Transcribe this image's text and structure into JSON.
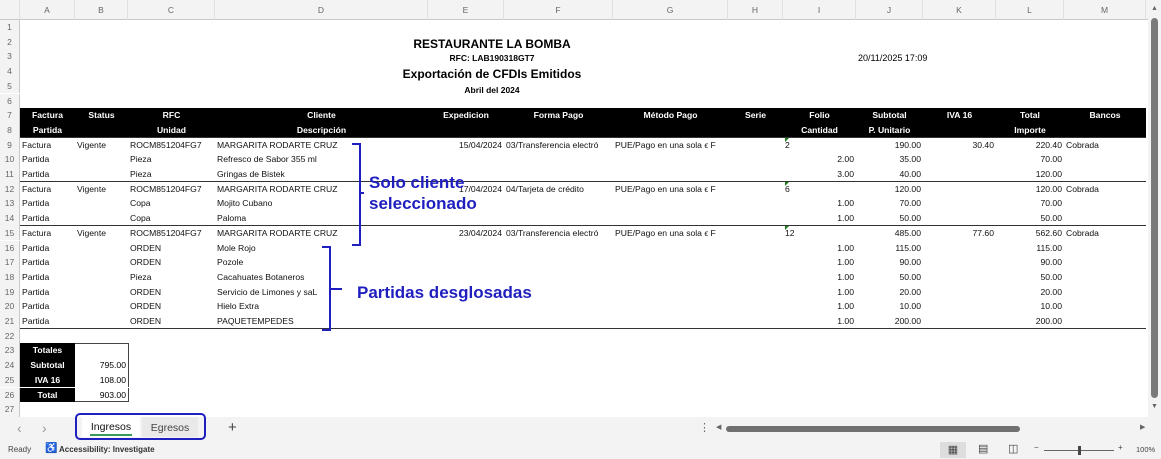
{
  "columns": [
    "A",
    "B",
    "C",
    "D",
    "E",
    "F",
    "G",
    "H",
    "I",
    "J",
    "K",
    "L",
    "M"
  ],
  "report": {
    "title": "RESTAURANTE LA BOMBA",
    "rfc": "RFC: LAB190318GT7",
    "subtitle": "Exportación de CFDIs Emitidos",
    "period": "Abril del 2024",
    "timestamp": "20/11/2025 17:09"
  },
  "header_row1": {
    "A": "Factura",
    "B": "Status",
    "C": "RFC",
    "D": "Cliente",
    "E": "Expedicion",
    "F": "Forma Pago",
    "G": "Método Pago",
    "H": "Serie",
    "I": "Folio",
    "J": "Subtotal",
    "K": "IVA 16",
    "L": "Total",
    "M": "Bancos"
  },
  "header_row2": {
    "A": "Partida",
    "C": "Unidad",
    "D": "Descripción",
    "I": "Cantidad",
    "J": "P. Unitario",
    "L": "Importe"
  },
  "rows": [
    {
      "n": 9,
      "type": "factura",
      "cells": {
        "A": "Factura",
        "B": "Vigente",
        "C": "ROCM851204FG7",
        "D": "MARGARITA RODARTE CRUZ",
        "E": "15/04/2024",
        "F": "03/Transferencia electró",
        "G": "PUE/Pago en una sola ϵ F",
        "I": "2",
        "J": "190.00",
        "K": "30.40",
        "L": "220.40",
        "M": "Cobrada"
      }
    },
    {
      "n": 10,
      "cells": {
        "A": "Partida",
        "C": "Pieza",
        "D": "Refresco de Sabor 355 ml",
        "I": "2.00",
        "J": "35.00",
        "L": "70.00"
      }
    },
    {
      "n": 11,
      "sep": true,
      "cells": {
        "A": "Partida",
        "C": "Pieza",
        "D": "Gringas de Bistek",
        "I": "3.00",
        "J": "40.00",
        "L": "120.00"
      }
    },
    {
      "n": 12,
      "type": "factura",
      "cells": {
        "A": "Factura",
        "B": "Vigente",
        "C": "ROCM851204FG7",
        "D": "MARGARITA RODARTE CRUZ",
        "E": "17/04/2024",
        "F": "04/Tarjeta de crédito",
        "G": "PUE/Pago en una sola ϵ F",
        "I": "6",
        "J": "120.00",
        "L": "120.00",
        "M": "Cobrada"
      }
    },
    {
      "n": 13,
      "cells": {
        "A": "Partida",
        "C": "Copa",
        "D": "Mojito Cubano",
        "I": "1.00",
        "J": "70.00",
        "L": "70.00"
      }
    },
    {
      "n": 14,
      "sep": true,
      "cells": {
        "A": "Partida",
        "C": "Copa",
        "D": "Paloma",
        "I": "1.00",
        "J": "50.00",
        "L": "50.00"
      }
    },
    {
      "n": 15,
      "type": "factura",
      "cells": {
        "A": "Factura",
        "B": "Vigente",
        "C": "ROCM851204FG7",
        "D": "MARGARITA RODARTE CRUZ",
        "E": "23/04/2024",
        "F": "03/Transferencia electró",
        "G": "PUE/Pago en una sola ϵ F",
        "I": "12",
        "J": "485.00",
        "K": "77.60",
        "L": "562.60",
        "M": "Cobrada"
      }
    },
    {
      "n": 16,
      "cells": {
        "A": "Partida",
        "C": "ORDEN",
        "D": "Mole Rojo",
        "I": "1.00",
        "J": "115.00",
        "L": "115.00"
      }
    },
    {
      "n": 17,
      "cells": {
        "A": "Partida",
        "C": "ORDEN",
        "D": "Pozole",
        "I": "1.00",
        "J": "90.00",
        "L": "90.00"
      }
    },
    {
      "n": 18,
      "cells": {
        "A": "Partida",
        "C": "Pieza",
        "D": "Cacahuates Botaneros",
        "I": "1.00",
        "J": "50.00",
        "L": "50.00"
      }
    },
    {
      "n": 19,
      "cells": {
        "A": "Partida",
        "C": "ORDEN",
        "D": "Servicio de Limones y saL",
        "I": "1.00",
        "J": "20.00",
        "L": "20.00"
      }
    },
    {
      "n": 20,
      "cells": {
        "A": "Partida",
        "C": "ORDEN",
        "D": "Hielo Extra",
        "I": "1.00",
        "J": "10.00",
        "L": "10.00"
      }
    },
    {
      "n": 21,
      "sep": true,
      "cells": {
        "A": "Partida",
        "C": "ORDEN",
        "D": "PAQUETEMPEDES",
        "I": "1.00",
        "J": "200.00",
        "L": "200.00"
      }
    }
  ],
  "totals": {
    "label": "Totales",
    "items": [
      {
        "label": "Subtotal",
        "value": "795.00"
      },
      {
        "label": "IVA 16",
        "value": "108.00"
      },
      {
        "label": "Total",
        "value": "903.00"
      }
    ]
  },
  "annotations": {
    "client": "Solo cliente\nseleccionado",
    "partidas": "Partidas desglosadas",
    "color": "#1f1fbf"
  },
  "sheets": {
    "tabs": [
      {
        "label": "Ingresos",
        "active": true
      },
      {
        "label": "Egresos",
        "active": false
      }
    ],
    "add": "+",
    "prev": "‹",
    "next": "›"
  },
  "statusbar": {
    "ready": "Ready",
    "accessibility": "Accessibility: Investigate",
    "zoom": "100%"
  }
}
